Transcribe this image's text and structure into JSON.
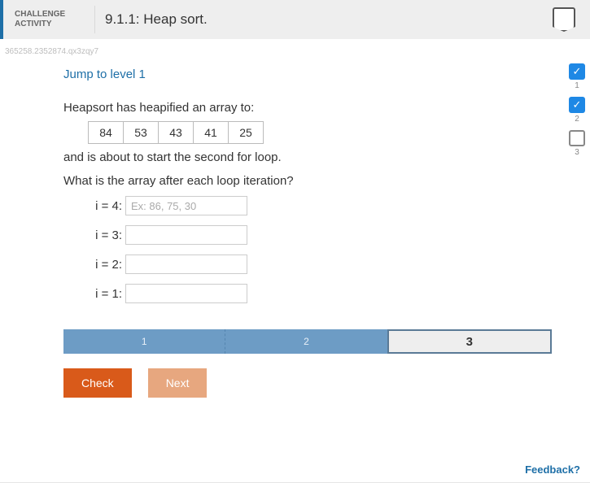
{
  "header": {
    "challenge_label_l1": "CHALLENGE",
    "challenge_label_l2": "ACTIVITY",
    "title": "9.1.1: Heap sort."
  },
  "serial": "365258.2352874.qx3zqy7",
  "jump_link": "Jump to level 1",
  "body": {
    "line1": "Heapsort has heapified an array to:",
    "array": [
      "84",
      "53",
      "43",
      "41",
      "25"
    ],
    "line2": "and is about to start the second for loop.",
    "question": "What is the array after each loop iteration?"
  },
  "inputs": {
    "rows": [
      {
        "label": "i = 4:",
        "placeholder": "Ex: 86, 75, 30",
        "value": ""
      },
      {
        "label": "i = 3:",
        "placeholder": "",
        "value": ""
      },
      {
        "label": "i = 2:",
        "placeholder": "",
        "value": ""
      },
      {
        "label": "i = 1:",
        "placeholder": "",
        "value": ""
      }
    ]
  },
  "progress": {
    "segments": [
      {
        "label": "1",
        "state": "done"
      },
      {
        "label": "2",
        "state": "done"
      },
      {
        "label": "3",
        "state": "current"
      }
    ]
  },
  "buttons": {
    "check": "Check",
    "next": "Next"
  },
  "side_levels": [
    {
      "num": "1",
      "state": "done"
    },
    {
      "num": "2",
      "state": "done"
    },
    {
      "num": "3",
      "state": "todo"
    }
  ],
  "feedback": "Feedback?",
  "icons": {
    "check": "✓"
  }
}
